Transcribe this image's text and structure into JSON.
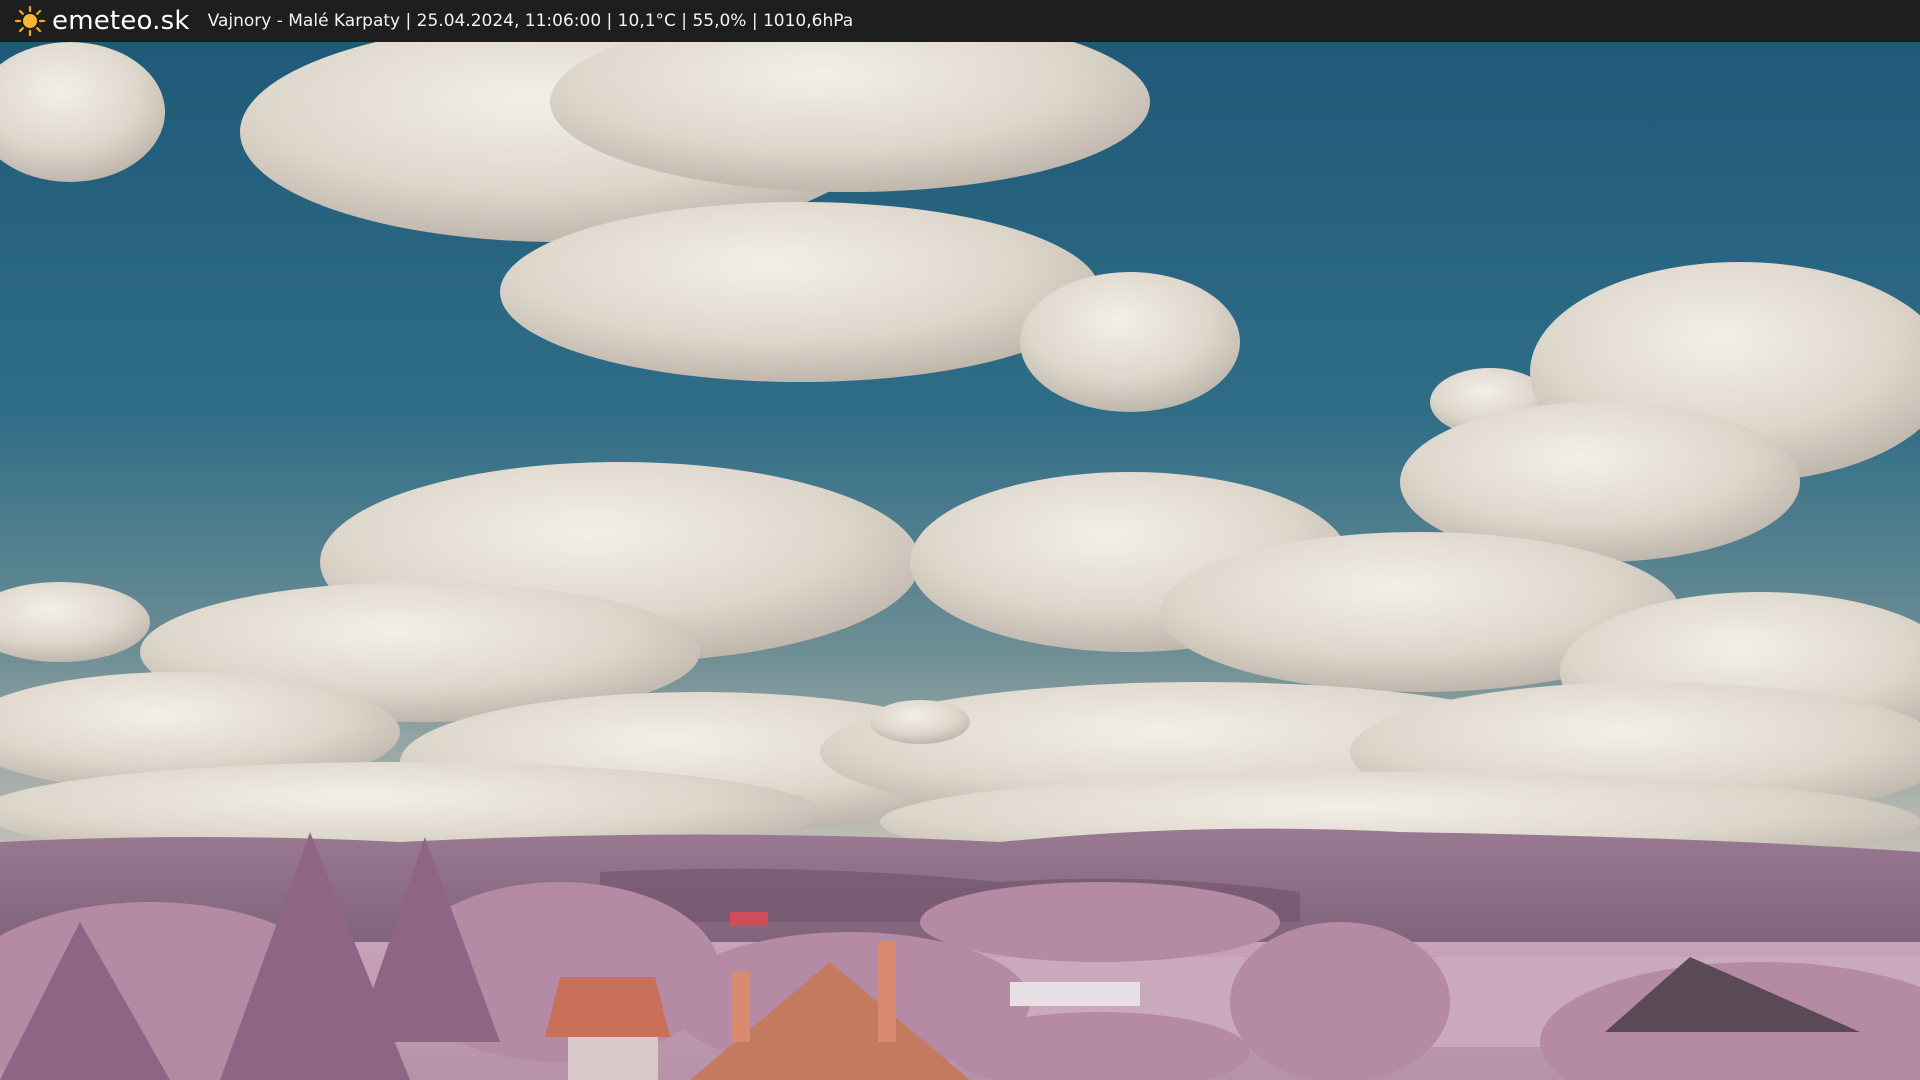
{
  "header": {
    "brand": "emeteo.sk",
    "brand_icon": "sun-icon",
    "info": "Vajnory - Malé Karpaty | 25.04.2024, 11:06:00 | 10,1°C | 55,0% | 1010,6hPa"
  },
  "colors": {
    "bar_background": "#1e1e1e",
    "sky": "#2e6a86",
    "cloud": "#e6e0d6",
    "hills": "#8a6b84",
    "vegetation": "#b98aa8",
    "roof": "#c9745a"
  }
}
